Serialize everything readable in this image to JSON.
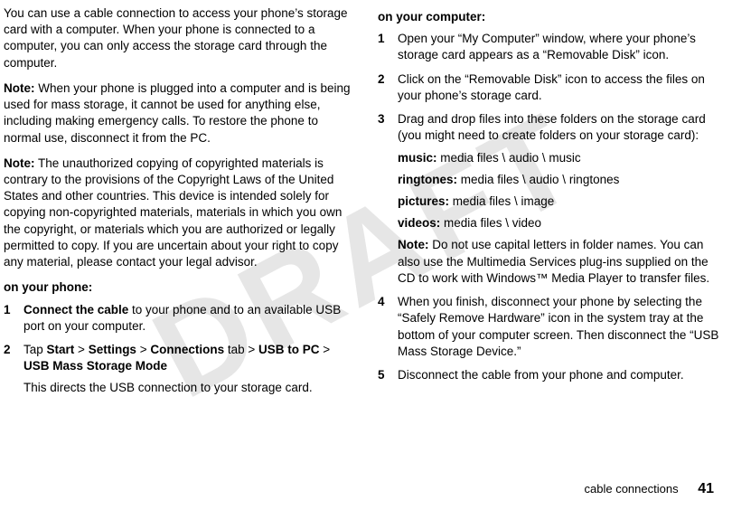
{
  "watermark": "DRAFT",
  "left": {
    "intro": "You can use a cable connection to access your phone’s storage card with a computer. When your phone is connected to a computer, you can only access the storage card through the computer.",
    "note1_label": "Note:",
    "note1": " When your phone is plugged into a computer and is being used for mass storage, it cannot be used for anything else, including making emergency calls. To restore the phone to normal use, disconnect it from the PC.",
    "note2_label": "Note:",
    "note2": " The unauthorized copying of copyrighted materials is contrary to the provisions of the Copyright Laws of the United States and other countries. This device is intended solely for copying non-copyrighted materials, materials in which you own the copyright, or materials which you are authorized or legally permitted to copy. If you are uncertain about your right to copy any material, please contact your legal advisor.",
    "phone_heading": "on your phone:",
    "step1_num": "1",
    "step1_lead": "Connect the cable",
    "step1_rest": " to your phone and to an available USB port on your computer.",
    "step2_num": "2",
    "step2_tap": "Tap ",
    "step2_path_start": "Start",
    "gt1": " > ",
    "step2_settings": "Settings",
    "gt2": " > ",
    "step2_conn": "Connections",
    "step2_tab": " tab > ",
    "step2_usb": "USB to PC",
    "gt3": " > ",
    "step2_mode": "USB Mass Storage Mode",
    "step2_foot": "This directs the USB connection to your storage card."
  },
  "right": {
    "computer_heading": "on your computer:",
    "s1_num": "1",
    "s1": "Open your “My Computer” window, where your phone’s storage card appears as a “Removable Disk” icon.",
    "s2_num": "2",
    "s2": "Click on the “Removable Disk” icon to access the files on your phone’s storage card.",
    "s3_num": "3",
    "s3_intro": "Drag and drop files into these folders on the storage card (you might need to create folders on your storage card):",
    "music_label": "music:",
    "music_path": " media files \\ audio \\ music",
    "ring_label": "ringtones:",
    "ring_path": " media files \\ audio \\ ringtones",
    "pic_label": "pictures:",
    "pic_path": " media files \\ image",
    "vid_label": "videos:",
    "vid_path": " media files \\ video",
    "s3_note_label": "Note:",
    "s3_note": " Do not use capital letters in folder names. You can also use the Multimedia Services plug-ins supplied on the CD to work with Windows™ Media Player to transfer files.",
    "s4_num": "4",
    "s4": "When you finish, disconnect your phone by selecting the “Safely Remove Hardware” icon in the system tray at the bottom of your computer screen. Then disconnect the “USB Mass Storage Device.”",
    "s5_num": "5",
    "s5": "Disconnect the cable from your phone and computer."
  },
  "footer": {
    "section": "cable connections",
    "page": "41"
  }
}
